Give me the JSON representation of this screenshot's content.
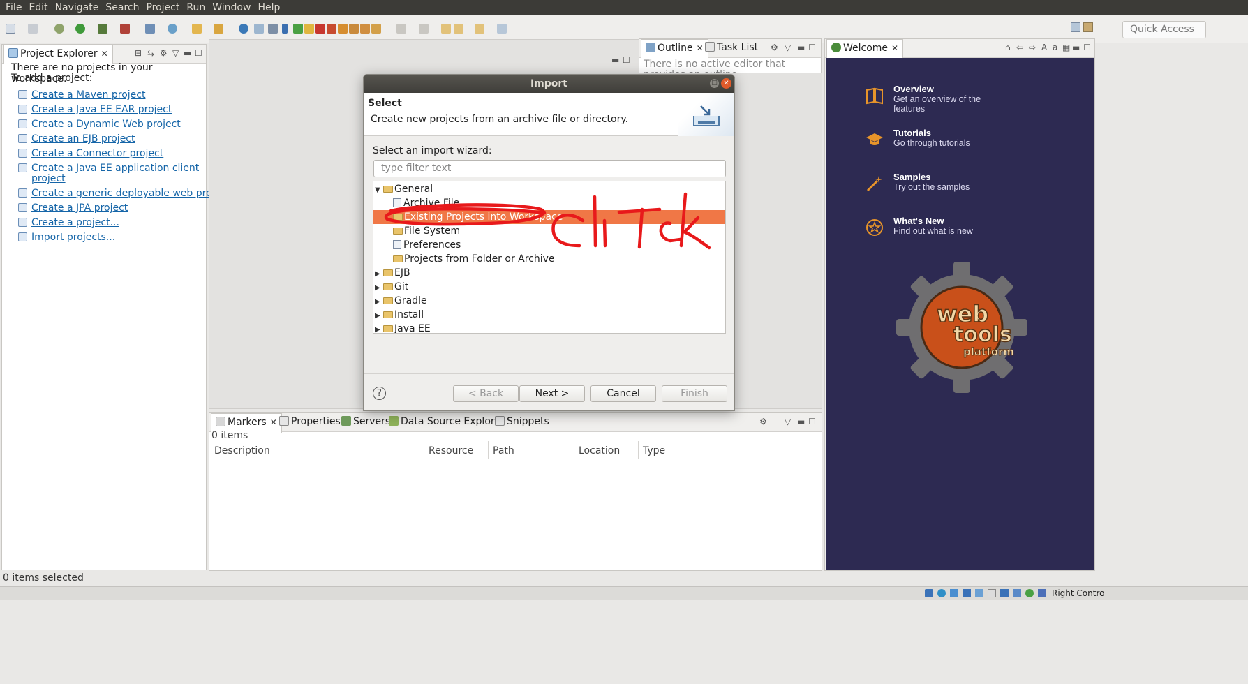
{
  "menu": [
    "File",
    "Edit",
    "Navigate",
    "Search",
    "Project",
    "Run",
    "Window",
    "Help"
  ],
  "toolbar": {
    "quick_access_placeholder": "Quick Access"
  },
  "project_explorer": {
    "tab_title": "Project Explorer",
    "intro_line1": "There are no projects in your workspace.",
    "intro_line2": "To add a project:",
    "links": [
      "Create a Maven project",
      "Create a Java EE EAR project",
      "Create a Dynamic Web project",
      "Create an EJB project",
      "Create a Connector project",
      "Create a Java EE application client",
      "project",
      "Create a generic deployable web project.",
      "Create a JPA project",
      "Create a project...",
      "Import projects..."
    ]
  },
  "outline": {
    "tab_outline": "Outline",
    "tab_tasklist": "Task List",
    "message": "There is no active editor that provides an outline."
  },
  "welcome": {
    "tab_title": "Welcome",
    "items": [
      {
        "title": "Overview",
        "desc1": "Get an overview of the",
        "desc2": "features",
        "icon": "book-icon"
      },
      {
        "title": "Tutorials",
        "desc1": "Go through tutorials",
        "desc2": "",
        "icon": "graduation-cap-icon"
      },
      {
        "title": "Samples",
        "desc1": "Try out the samples",
        "desc2": "",
        "icon": "magic-wand-icon"
      },
      {
        "title": "What's New",
        "desc1": "Find out what is new",
        "desc2": "",
        "icon": "star-icon"
      }
    ],
    "logo_line1": "web",
    "logo_line2": "tools",
    "logo_line3": "platform"
  },
  "markers": {
    "tabs": [
      "Markers",
      "Properties",
      "Servers",
      "Data Source Explorer",
      "Snippets"
    ],
    "count": "0 items",
    "columns": [
      "Description",
      "Resource",
      "Path",
      "Location",
      "Type"
    ]
  },
  "status": {
    "text": "0 items selected",
    "taskbar_label": "Right Contro"
  },
  "dialog": {
    "title": "Import",
    "header_title": "Select",
    "header_desc": "Create new projects from an archive file or directory.",
    "wizard_label": "Select an import wizard:",
    "filter_placeholder": "type filter text",
    "tree": {
      "general": "General",
      "children": [
        "Archive File",
        "Existing Projects into Workspace",
        "File System",
        "Preferences",
        "Projects from Folder or Archive"
      ],
      "others": [
        "EJB",
        "Git",
        "Gradle",
        "Install",
        "Java EE"
      ]
    },
    "buttons": {
      "back": "< Back",
      "next": "Next >",
      "cancel": "Cancel",
      "finish": "Finish"
    },
    "help": "?"
  },
  "annotation": {
    "text": "click",
    "color": "#e8191b"
  }
}
